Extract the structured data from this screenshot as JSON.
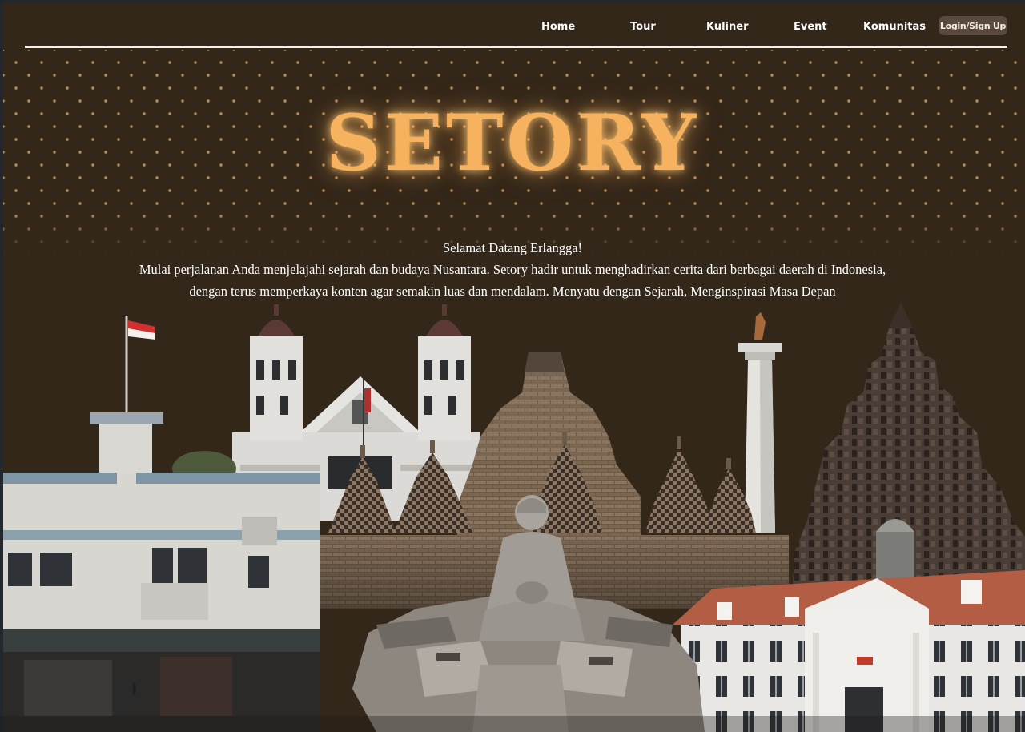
{
  "nav": {
    "items": [
      "Home",
      "Tour",
      "Kuliner",
      "Event",
      "Komunitas"
    ],
    "login_label": "Login/Sign Up"
  },
  "hero": {
    "title": "SETORY",
    "greeting": "Selamat Datang Erlangga!",
    "line1": "Mulai perjalanan Anda menjelajahi sejarah dan budaya Nusantara. Setory hadir untuk menghadirkan cerita dari berbagai daerah di Indonesia,",
    "line2": "dengan terus memperkaya konten agar semakin luas dan mendalam. Menyatu dengan Sejarah, Menginspirasi Masa Depan"
  },
  "colors": {
    "background": "#33271a",
    "accent": "#f6b25f",
    "dots": "#b7844d",
    "button": "#5a4a3e"
  },
  "illustration": {
    "elements": [
      "indonesian-flag",
      "colonial-white-building",
      "lawang-sewu-towers",
      "borobudur-stupas",
      "buddha-statue",
      "monas-monument",
      "prambanan-temple",
      "dutch-colonial-museum"
    ]
  }
}
